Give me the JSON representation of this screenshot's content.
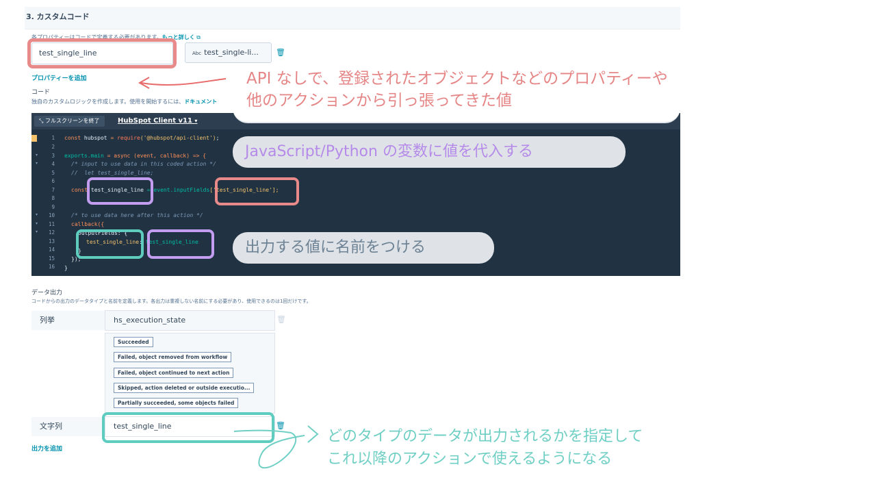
{
  "section": {
    "title": "3. カスタムコード"
  },
  "properties": {
    "hint": "各プロパティーはコードで定義する必要があります。",
    "learn_more": "もっと詳しく",
    "var_name": "test_single_line",
    "prop_value": "test_single-li...",
    "prop_type": "Abc",
    "add_property": "プロパティーを追加"
  },
  "code": {
    "label": "コード",
    "description": "独自のカスタムロジックを作成します。使用を開始するには、",
    "doc_link": "ドキュメント",
    "exit_fullscreen": "フルスクリーンを終了",
    "client_version": "HubSpot Client v11",
    "line_numbers": [
      "1",
      "2",
      "3",
      "4",
      "5",
      "6",
      "7",
      "8",
      "9",
      "10",
      "11",
      "12",
      "13",
      "14",
      "15",
      "16"
    ],
    "lines": {
      "l1_kw": "const",
      "l1_var": " hubspot ",
      "l1_eq": "= ",
      "l1_fn": "require",
      "l1_str": "('@hubspot/api-client')",
      "l1_end": ";",
      "l3_obj": "exports",
      "l3_prop": ".main",
      "l3_rest": " = async (event, callback) => {",
      "l4": "/* input to use data in this coded action */",
      "l5": "//  let test_single_line;",
      "l7_kw": "const",
      "l7_var": " test_single_line ",
      "l7_rest": "= event.inputFields",
      "l7_str": "['test_single_line'];",
      "l10": "/* to use data here after this action */",
      "l11": "callback({",
      "l12": "outputFields: {",
      "l13_key": "test_single_line",
      "l13_sep": ": ",
      "l13_val": "test_single_line",
      "l14": "}",
      "l15": "});",
      "l16": "}"
    }
  },
  "output": {
    "label": "データ出力",
    "description": "コードからの出力のデータタイプと名前を定義します。各出力は重複しない名前にする必要があり、使用できるのは1回だけです。",
    "rows": [
      {
        "type": "列挙",
        "name": "hs_execution_state"
      },
      {
        "type": "文字列",
        "name": "test_single_line"
      }
    ],
    "options": [
      "Succeeded",
      "Failed, object removed from workflow",
      "Failed, object continued to next action",
      "Skipped, action deleted or outside executio...",
      "Partially succeeded, some objects failed"
    ],
    "add_output": "出力を追加"
  },
  "annotations": {
    "red_line1": "API なしで、登録されたオブジェクトなどのプロパティーや",
    "red_line2": "他のアクションから引っ張ってきた値",
    "purple": "JavaScript/Python の変数に値を代入する",
    "gray": "出力する値に名前をつける",
    "teal_line1": "どのタイプのデータが出力されるかを指定して",
    "teal_line2": "これ以降のアクションで使えるようになる"
  },
  "colors": {
    "red": "#e88a8a",
    "purple": "#c39ef0",
    "teal": "#5ecdc0",
    "link": "#0091ae",
    "editor_bg": "#213343"
  },
  "icons": [
    "external-link-icon",
    "trash-icon",
    "collapse-icon",
    "caret-down-icon",
    "fold-arrow-icon",
    "marker-icon"
  ]
}
